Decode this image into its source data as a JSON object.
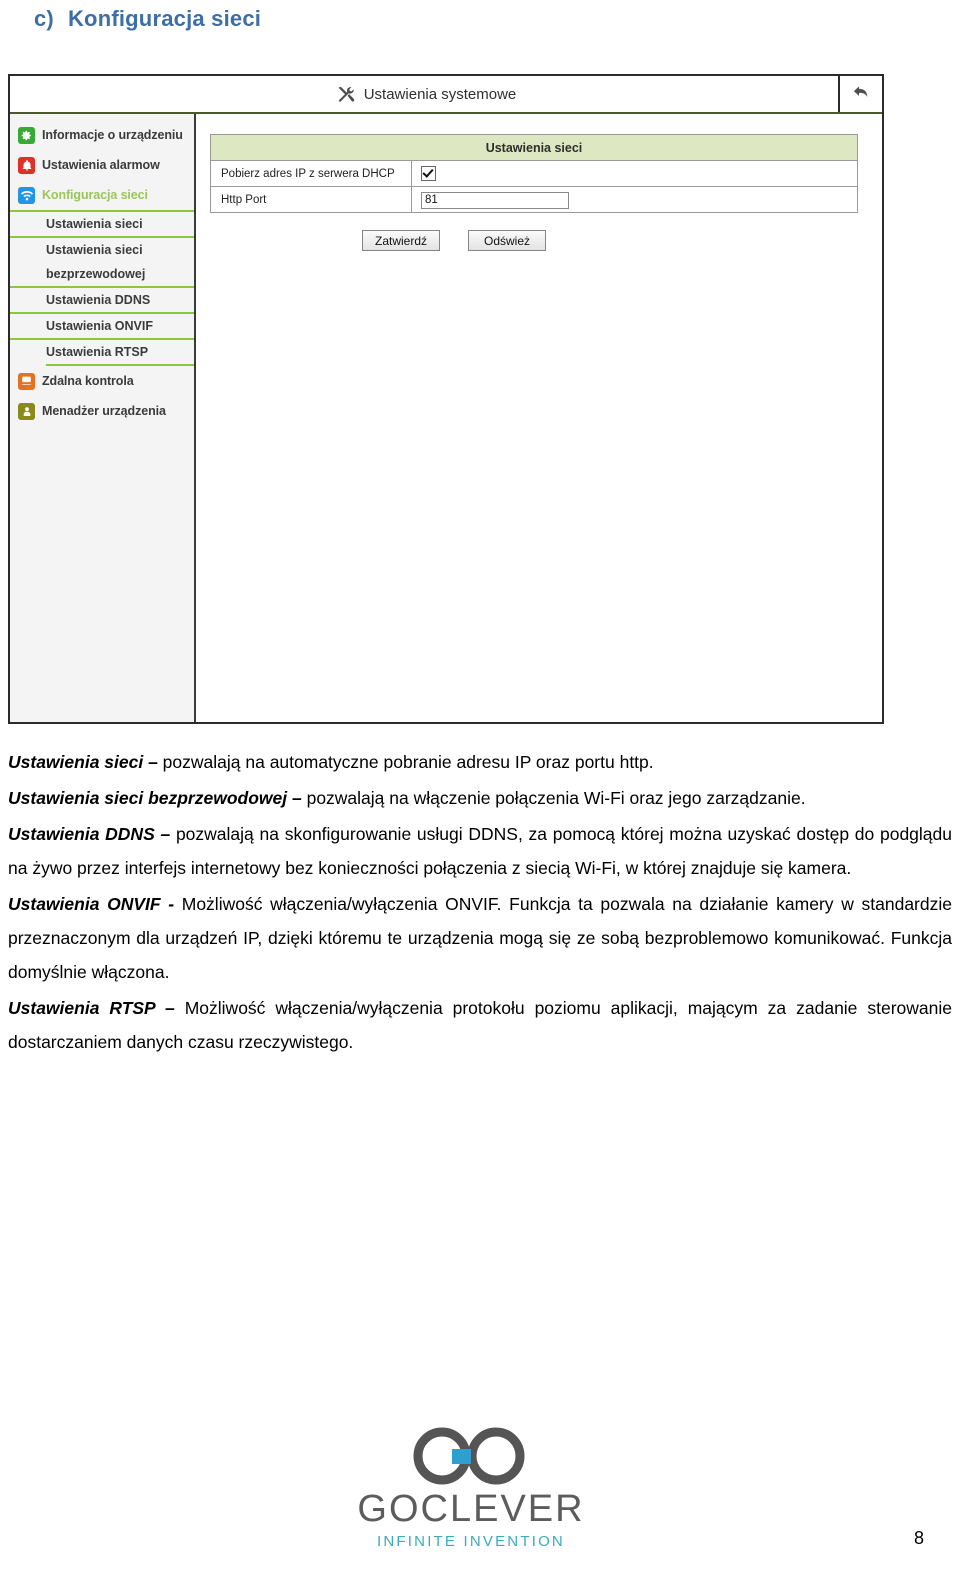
{
  "heading": {
    "marker": "c)",
    "text": "Konfiguracja sieci",
    "color": "#3d6ea5"
  },
  "screenshot": {
    "titlebar": {
      "title": "Ustawienia systemowe",
      "tools_icon": "tools-icon",
      "back_icon": "back-arrow-icon"
    },
    "sidebar": {
      "items": [
        {
          "label": "Informacje o urządzeniu",
          "icon": "gear-icon",
          "color": "#3aa836",
          "type": "main",
          "active": false
        },
        {
          "label": "Ustawienia alarmow",
          "icon": "bell-icon",
          "color": "#e0302a",
          "type": "main",
          "active": false
        },
        {
          "label": "Konfiguracja sieci",
          "icon": "wifi-icon",
          "color": "#2196e8",
          "type": "main",
          "active": true
        },
        {
          "label": "Ustawienia sieci",
          "type": "sub"
        },
        {
          "label": "Ustawienia sieci",
          "type": "sub"
        },
        {
          "label": "bezprzewodowej",
          "type": "sub-cont"
        },
        {
          "label": "Ustawienia DDNS",
          "type": "sub"
        },
        {
          "label": "Ustawienia ONVIF",
          "type": "sub"
        },
        {
          "label": "Ustawienia RTSP",
          "type": "sub"
        },
        {
          "label": "Zdalna kontrola",
          "icon": "remote-control-icon",
          "color": "#e8711f",
          "type": "main",
          "active": false
        },
        {
          "label": "Menadżer urządzenia",
          "icon": "user-icon",
          "color": "#8a8a18",
          "type": "main",
          "active": false
        }
      ]
    },
    "panel": {
      "table_header": "Ustawienia sieci",
      "rows": [
        {
          "label": "Pobierz adres IP z serwera DHCP",
          "control": "checkbox",
          "checked": true
        },
        {
          "label": "Http Port",
          "control": "text",
          "value": "81"
        }
      ],
      "buttons": {
        "submit": "Zatwierdź",
        "refresh": "Odśwież"
      }
    }
  },
  "prose": {
    "p1_term": "Ustawienia sieci –",
    "p1_body": " pozwalają na automatyczne pobranie adresu IP oraz portu http.",
    "p2_term": "Ustawienia sieci bezprzewodowej –",
    "p2_body": " pozwalają na włączenie połączenia Wi-Fi oraz jego zarządzanie.",
    "p3_term": "Ustawienia DDNS –",
    "p3_body": " pozwalają na skonfigurowanie usługi DDNS, za pomocą której można uzyskać dostęp do podglądu na żywo przez interfejs internetowy bez konieczności połączenia z siecią Wi-Fi, w której znajduje się kamera.",
    "p4_term": "Ustawienia ONVIF -",
    "p4_body": "  Możliwość włączenia/wyłączenia ONVIF. Funkcja ta pozwala na działanie kamery w standardzie przeznaczonym dla urządzeń IP, dzięki któremu te urządzenia mogą się ze sobą bezproblemowo komunikować. Funkcja domyślnie włączona.",
    "p5_term": "Ustawienia RTSP –",
    "p5_body": " Możliwość włączenia/wyłączenia protokołu poziomu aplikacji, mającym za zadanie sterowanie dostarczaniem danych czasu rzeczywistego."
  },
  "logo": {
    "wordmark": "GOCLEVER",
    "tagline": "INFINITE INVENTION",
    "mark_color": "#555555",
    "accent_color": "#2f9fd0",
    "tagline_color": "#3ea8bd"
  },
  "footer": {
    "page_number": "8"
  }
}
